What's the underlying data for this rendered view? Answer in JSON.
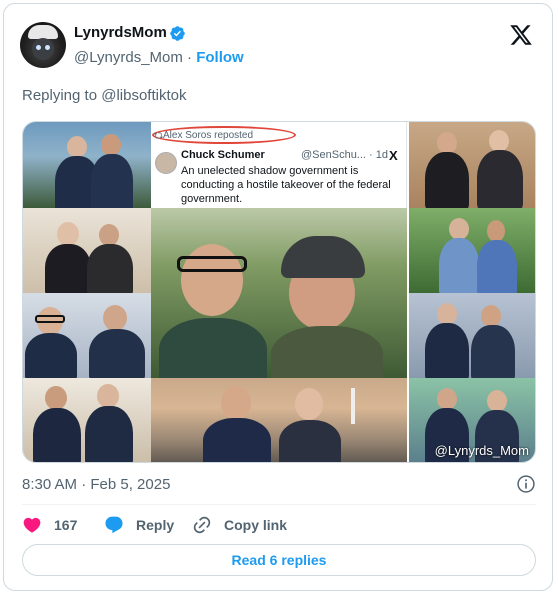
{
  "author": {
    "display_name": "LynyrdsMom",
    "handle": "@Lynyrds_Mom",
    "separator": " · ",
    "follow_label": "Follow",
    "verified": true
  },
  "reply_context": {
    "prefix": "Replying to ",
    "mention": "@libsoftiktok"
  },
  "media": {
    "embedded_tweet": {
      "repost_label": "Alex Soros reposted",
      "name": "Chuck Schumer",
      "handle": "@SenSchu... · 1d",
      "text": "An unelected shadow government is conducting a hostile takeover of the federal government.",
      "logo": "X"
    },
    "watermark": "@Lynyrds_Mom"
  },
  "meta": {
    "timestamp": "8:30 AM · Feb 5, 2025"
  },
  "actions": {
    "like_count": "167",
    "reply_label": "Reply",
    "copy_link_label": "Copy link",
    "read_replies_label": "Read 6 replies"
  },
  "colors": {
    "accent": "#1d9bf0",
    "like": "#f91880",
    "muted": "#536471",
    "border": "#cfd9de"
  },
  "icons": [
    "verified-badge-icon",
    "x-logo-icon",
    "info-icon",
    "heart-icon",
    "reply-bubble-icon",
    "link-icon",
    "repost-icon"
  ]
}
